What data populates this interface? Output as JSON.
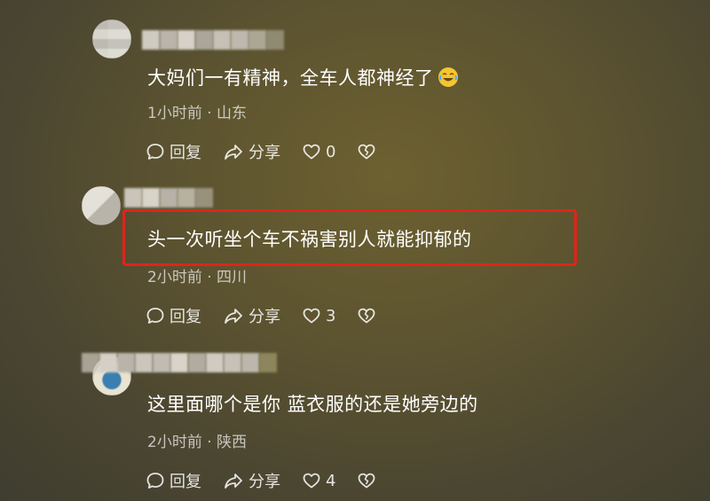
{
  "comments": [
    {
      "text": "大妈们一有精神，全车人都神经了",
      "emoji": "crying-laughing-emoji",
      "time": "1小时前",
      "location": "山东",
      "reply_label": "回复",
      "share_label": "分享",
      "likes": "0"
    },
    {
      "text": "头一次听坐个车不祸害别人就能抑郁的",
      "time": "2小时前",
      "location": "四川",
      "reply_label": "回复",
      "share_label": "分享",
      "likes": "3"
    },
    {
      "text": "这里面哪个是你 蓝衣服的还是她旁边的",
      "time": "2小时前",
      "location": "陕西",
      "reply_label": "回复",
      "share_label": "分享",
      "likes": "4"
    }
  ],
  "meta_separator": " · ",
  "colors": {
    "highlight_border": "#e0241b",
    "text_primary": "#ffffff",
    "text_secondary": "rgba(255,255,255,0.68)"
  }
}
